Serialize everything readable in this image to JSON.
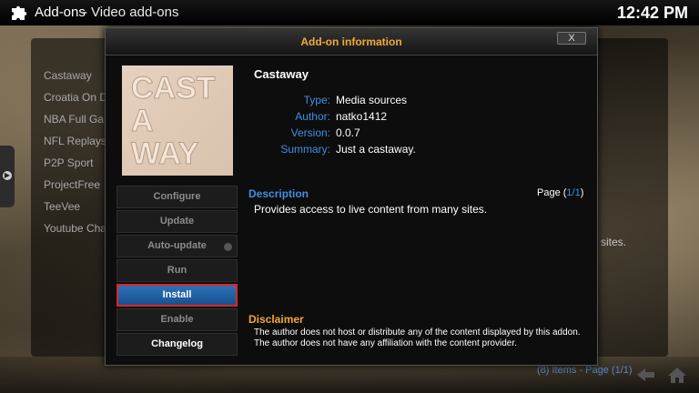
{
  "topbar": {
    "section": "Add-ons",
    "separator": "-",
    "subsection": "Video add-ons",
    "clock": "12:42 PM"
  },
  "background_list": {
    "items": [
      "Castaway",
      "Croatia On D",
      "NBA Full Ga",
      "NFL Replays",
      "P2P Sport",
      "ProjectFree",
      "TeeVee",
      "Youtube Cha"
    ],
    "fragment": "sites."
  },
  "footer": {
    "items_text": "(8) Items - Page (",
    "page": "1/1",
    "close": ")"
  },
  "dialog": {
    "title": "Add-on information",
    "close_label": "X",
    "addon": {
      "name": "Castaway",
      "thumbnail_text": [
        "CAST",
        "A",
        "WAY"
      ],
      "fields": [
        {
          "key": "Type:",
          "value": "Media sources"
        },
        {
          "key": "Author:",
          "value": "natko1412"
        },
        {
          "key": "Version:",
          "value": "0.0.7"
        },
        {
          "key": "Summary:",
          "value": "Just a castaway."
        }
      ]
    },
    "buttons": {
      "configure": "Configure",
      "update": "Update",
      "auto_update": "Auto-update",
      "run": "Run",
      "install": "Install",
      "enable": "Enable",
      "changelog": "Changelog"
    },
    "description": {
      "title": "Description",
      "page_prefix": "Page (",
      "page": "1/1",
      "page_suffix": ")",
      "text": "Provides access to live content from many sites."
    },
    "disclaimer": {
      "title": "Disclaimer",
      "text": "The author does not host or distribute any of the content displayed by this addon. The author does not have any affiliation with the content provider."
    }
  },
  "colors": {
    "accent_blue": "#3f8fe0",
    "accent_orange": "#f1a83a",
    "highlight_red": "#e0261f"
  }
}
